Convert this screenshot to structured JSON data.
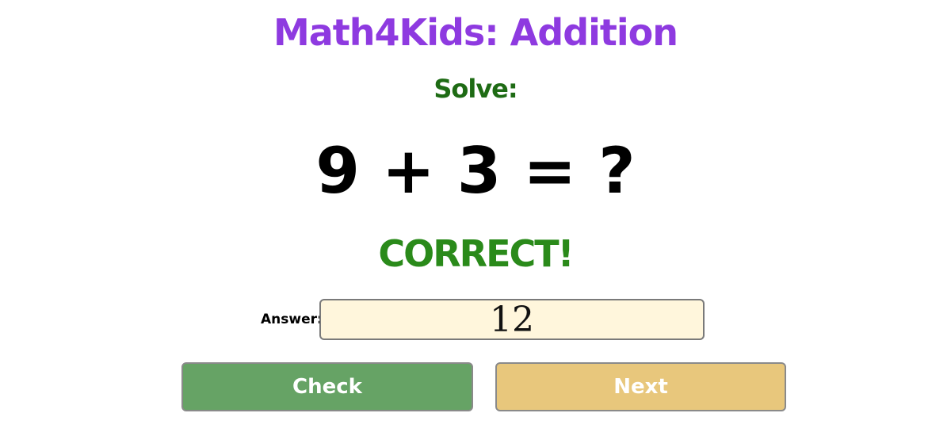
{
  "title": "Math4Kids: Addition",
  "prompt": "Solve:",
  "problem": {
    "display": "9 + 3 = ?"
  },
  "feedback": "CORRECT!",
  "answer": {
    "label": "Answer:",
    "value": "12"
  },
  "buttons": {
    "check": "Check",
    "next": "Next"
  },
  "colors": {
    "title": "#8e3ae0",
    "prompt": "#1e6b14",
    "feedback": "#2a8a1a",
    "check_button": "#66a365",
    "next_button": "#e8c77c",
    "answer_background": "#fff6dc"
  }
}
